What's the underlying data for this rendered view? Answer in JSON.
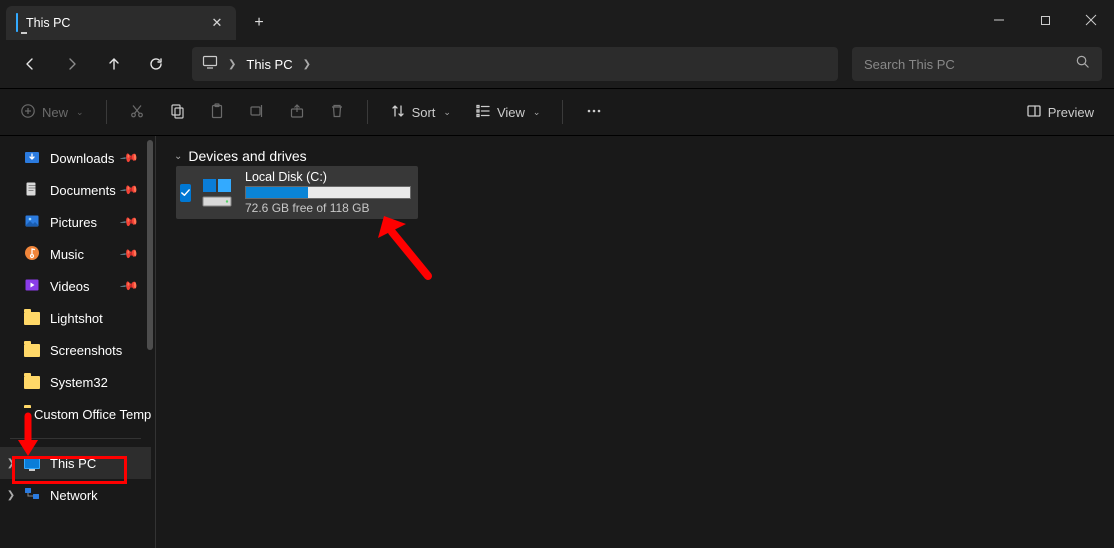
{
  "tab": {
    "title": "This PC"
  },
  "breadcrumb": {
    "location": "This PC"
  },
  "search": {
    "placeholder": "Search This PC"
  },
  "toolbar": {
    "new": "New",
    "sort": "Sort",
    "view": "View",
    "preview": "Preview"
  },
  "sidebar": {
    "items": [
      {
        "label": "Downloads",
        "icon": "downloads",
        "pinned": true
      },
      {
        "label": "Documents",
        "icon": "documents",
        "pinned": true
      },
      {
        "label": "Pictures",
        "icon": "pictures",
        "pinned": true
      },
      {
        "label": "Music",
        "icon": "music",
        "pinned": true
      },
      {
        "label": "Videos",
        "icon": "videos",
        "pinned": true
      },
      {
        "label": "Lightshot",
        "icon": "folder"
      },
      {
        "label": "Screenshots",
        "icon": "folder"
      },
      {
        "label": "System32",
        "icon": "folder"
      },
      {
        "label": "Custom Office Templates",
        "icon": "folder"
      }
    ],
    "roots": [
      {
        "label": "This PC",
        "icon": "thispc",
        "expandable": true,
        "selected": true
      },
      {
        "label": "Network",
        "icon": "network",
        "expandable": true
      }
    ]
  },
  "content": {
    "group_header": "Devices and drives",
    "drive": {
      "name": "Local Disk (C:)",
      "free_text": "72.6 GB free of 118 GB",
      "used_pct": 38
    }
  }
}
